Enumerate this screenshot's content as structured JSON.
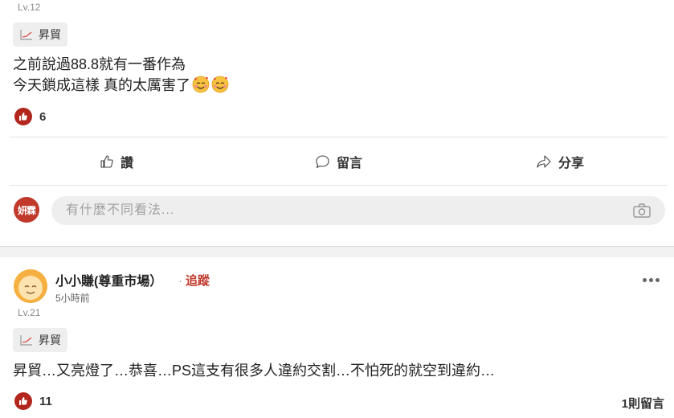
{
  "post1": {
    "level": "Lv.12",
    "tag": "昇貿",
    "text_line1": "之前說過88.8就有一番作為",
    "text_line2": "今天鎖成這樣 真的太厲害了",
    "emoji_icon": "smiling-face-with-hearts",
    "likes": "6",
    "actions": {
      "like": "讚",
      "comment": "留言",
      "share": "分享"
    },
    "commenter_avatar_text": "妍霖",
    "comment_placeholder": "有什麼不同看法..."
  },
  "post2": {
    "username": "小小賺(尊重市場）",
    "follow_label": "追蹤",
    "time": "5小時前",
    "level": "Lv.21",
    "tag": "昇貿",
    "text": "昇貿…又亮燈了…恭喜…PS這支有很多人違約交割…不怕死的就空到違約…",
    "likes": "11",
    "reply_count": "1則留言"
  },
  "colors": {
    "accent_red": "#c0392b",
    "like_badge": "#b3261e",
    "avatar_orange": "#f5b041"
  }
}
